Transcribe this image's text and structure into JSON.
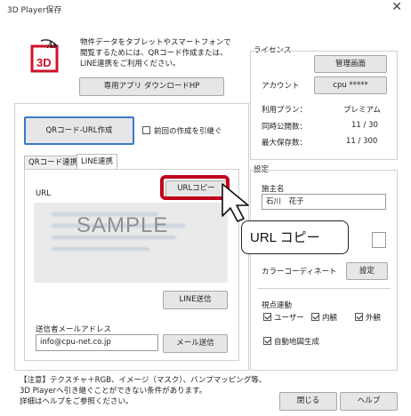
{
  "window": {
    "title": "3D Player保存",
    "close": "✕"
  },
  "intro": {
    "text_l1": "物件データをタブレットやスマートフォンで",
    "text_l2": "閲覧するためには、QRコード作成または、",
    "text_l3": "LINE連携をご利用ください。",
    "app_download": "専用アプリ ダウンロードHP"
  },
  "qr": {
    "create_button": "QRコード-URL作成",
    "inherit_label": "前回の作成を引継ぐ"
  },
  "tabs": [
    "QRコード連携",
    "LINE連携"
  ],
  "line": {
    "url_label": "URL",
    "url_copy": "URLコピー",
    "sample_watermark": "SAMPLE",
    "line_send": "LINE送信",
    "sender_label": "送信者メールアドレス",
    "sender_value": "info@cpu-net.co.jp",
    "mail_send": "メール送信"
  },
  "callout": {
    "text": "URL コピー"
  },
  "license": {
    "heading": "ライセンス",
    "admin_button": "管理画面",
    "account_label": "アカウント",
    "account_value": "cpu *****",
    "plan_label": "利用プラン：",
    "plan_value": "プレミアム",
    "simul_label": "同時公開数：",
    "simul_value": "11 / 30",
    "max_label": "最大保存数：",
    "max_value": "11 / 300"
  },
  "settings": {
    "heading": "設定",
    "owner_label": "施主名",
    "owner_value": "石川　花子",
    "color_label": "カラーコーディネート",
    "color_button": "設定",
    "viewpoint_label": "視点連動",
    "user_label": "ユーザー",
    "interior_label": "内観",
    "exterior_label": "外観",
    "auto_label": "自動地図生成"
  },
  "note": {
    "l1": "【注意】テクスチャ＋RGB、イメージ（マスク）、バンプマッピング等、",
    "l2": "3D Playerへ引き継ぐことができない条件があります。",
    "l3": "詳細はヘルプをご参照ください。"
  },
  "footer": {
    "close_button": "閉じる",
    "help_button": "ヘルプ"
  },
  "colors": {
    "highlight_red": "#c0001a",
    "logo_red": "#d0102a"
  }
}
